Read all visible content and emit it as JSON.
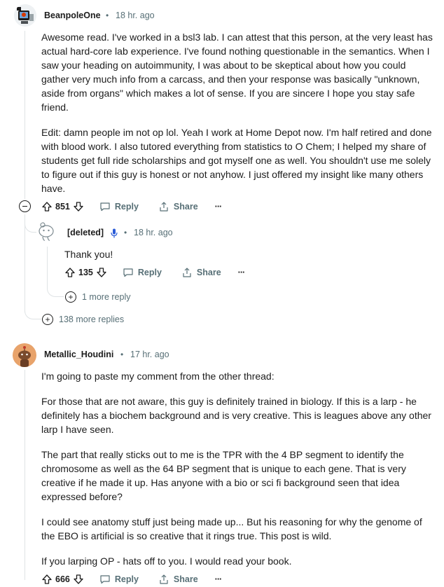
{
  "comments": [
    {
      "author": "BeanpoleOne",
      "time": "18 hr. ago",
      "paragraphs": [
        "Awesome read. I've worked in a bsl3 lab. I can attest that this person, at the very least has actual hard-core lab experience. I've found nothing questionable in the semantics. When I saw your heading on autoimmunity, I was about to be skeptical about how you could gather very much info from a carcass, and then your response was basically \"unknown, aside from organs\" which makes a lot of sense. If you are sincere I hope you stay safe friend.",
        "Edit: damn people im not op lol. Yeah I work at Home Depot now. I'm half retired and done with blood work. I also tutored everything from statistics to O Chem; I helped my share of students get full ride scholarships and got myself one as well. You shouldn't use me solely to figure out if this guy is honest or not anyhow. I just offered my insight like many others have."
      ],
      "votes": "851",
      "reply_label": "Reply",
      "share_label": "Share",
      "more_label": "···",
      "more_replies": "138 more replies"
    },
    {
      "author": "[deleted]",
      "time": "18 hr. ago",
      "text": "Thank you!",
      "votes": "135",
      "reply_label": "Reply",
      "share_label": "Share",
      "more_label": "···",
      "more_reply": "1 more reply"
    },
    {
      "author": "Metallic_Houdini",
      "time": "17 hr. ago",
      "paragraphs": [
        "I'm going to paste my comment from the other thread:",
        "For those that are not aware, this guy is definitely trained in biology. If this is a larp - he definitely has a biochem background and is very creative. This is leagues above any other larp I have seen.",
        "The part that really sticks out to me is the TPR with the 4 BP segment to identify the chromosome as well as the 64 BP segment that is unique to each gene. That is very creative if he made it up. Has anyone with a bio or sci fi background seen that idea expressed before?",
        "I could see anatomy stuff just being made up... But his reasoning for why the genome of the EBO is artificial is so creative that it rings true. This post is wild.",
        "If you larping OP - hats off to you. I would read your book."
      ],
      "votes": "666",
      "reply_label": "Reply",
      "share_label": "Share",
      "more_label": "···"
    }
  ],
  "separator": "•",
  "colors": {
    "meta": "#576f76",
    "text": "#1c1c1c",
    "line": "#dfe3e5",
    "mic": "#2a5bd7",
    "orange_avatar": "#e8a36b"
  }
}
